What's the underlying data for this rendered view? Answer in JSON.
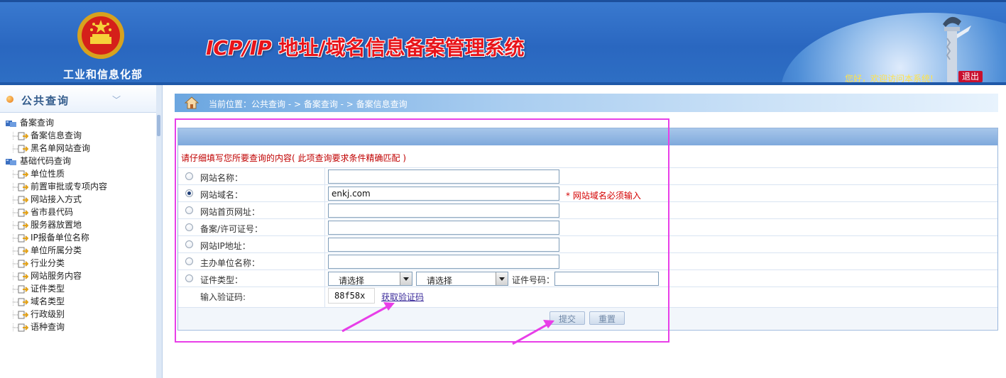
{
  "colors": {
    "header_blue": "#2a67c0",
    "title_red": "#e8141a",
    "required_red": "#d40000",
    "annotation_magenta": "#e83ee8"
  },
  "header": {
    "ministry": "工业和信息化部",
    "title_prefix": "ICP/IP",
    "title_rest": " 地址/域名信息备案管理系统",
    "welcome": "您好，欢迎访问本系统!",
    "logout": "退出",
    "emblem_icon": "national-emblem-icon",
    "pillar_icon": "huabiao-pillar-icon"
  },
  "sidebar": {
    "title": "公共查询",
    "chevron": "﹀",
    "groups": [
      {
        "label": "备案查询",
        "items": [
          "备案信息查询",
          "黑名单网站查询"
        ]
      },
      {
        "label": "基础代码查询",
        "items": [
          "单位性质",
          "前置审批或专项内容",
          "网站接入方式",
          "省市县代码",
          "服务器放置地",
          "IP报备单位名称",
          "单位所属分类",
          "行业分类",
          "网站服务内容",
          "证件类型",
          "域名类型",
          "行政级别",
          "语种查询"
        ]
      }
    ]
  },
  "breadcrumb": {
    "text": "当前位置：公共查询  - >  备案查询  - > 备案信息查询"
  },
  "form": {
    "notice": "请仔细填写您所要查询的内容( 此项查询要求条件精确匹配 )",
    "fields": [
      {
        "label": "网站名称：",
        "value": "",
        "checked": false
      },
      {
        "label": "网站域名：",
        "value": "enkj.com",
        "checked": true,
        "required": "* 网站域名必须输入"
      },
      {
        "label": "网站首页网址：",
        "value": "",
        "checked": false
      },
      {
        "label": "备案/许可证号：",
        "value": "",
        "checked": false
      },
      {
        "label": "网站IP地址：",
        "value": "",
        "checked": false
      },
      {
        "label": "主办单位名称：",
        "value": "",
        "checked": false
      }
    ],
    "cert": {
      "label": "证件类型：",
      "select1": "请选择",
      "select2": "请选择",
      "number_label": "证件号码：",
      "number_value": ""
    },
    "captcha": {
      "label": "输入验证码:",
      "code": "88f58x",
      "link": "获取验证码"
    },
    "submit": "提交",
    "reset": "重置"
  }
}
